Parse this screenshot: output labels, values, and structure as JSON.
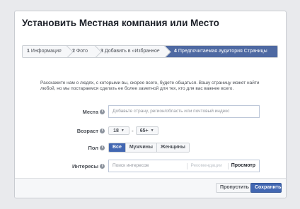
{
  "dialog": {
    "title": "Установить Местная компания или Место",
    "steps": [
      {
        "num": "1",
        "label": "Информация"
      },
      {
        "num": "2",
        "label": "Фото"
      },
      {
        "num": "3",
        "label": "Добавить в «Избранное»"
      },
      {
        "num": "4",
        "label": "Предпочитаемая аудитория Страницы"
      }
    ],
    "active_step": 4,
    "description": "Расскажите нам о людях, с которыми вы, скорее всего, будете общаться. Вашу страницу может найти любой, но мы постараемся сделать ее более заметной для тех, кто для вас важнее всего.",
    "fields": {
      "places": {
        "label": "Места",
        "placeholder": "Добавьте страну, регион/область или почтовый индекс"
      },
      "age": {
        "label": "Возраст",
        "from": "18",
        "to": "65+"
      },
      "gender": {
        "label": "Пол",
        "options": [
          "Все",
          "Мужчины",
          "Женщины"
        ],
        "selected": "Все"
      },
      "interests": {
        "label": "Интересы",
        "placeholder": "Поиск интересов",
        "suggestions_link": "Рекомендации",
        "browse_link": "Просмотр"
      }
    },
    "info_glyph": "i",
    "caret_glyph": "▼",
    "dash": "-",
    "footer": {
      "skip_label": "Пропустить",
      "save_label": "Сохранить"
    }
  },
  "colors": {
    "accent": "#4267b2",
    "active_step": "#4e69a2",
    "background": "#e9eaed"
  }
}
